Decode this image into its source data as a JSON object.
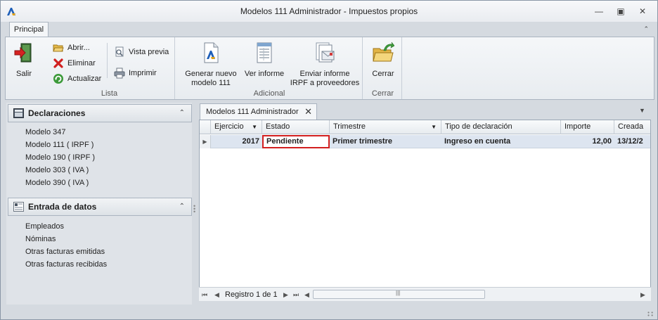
{
  "window": {
    "title": "Modelos 111 Administrador - Impuestos propios"
  },
  "ribbon": {
    "tabs": [
      "Principal"
    ],
    "salir": "Salir",
    "abrir": "Abrir...",
    "eliminar": "Eliminar",
    "actualizar": "Actualizar",
    "vista_previa": "Vista previa",
    "imprimir": "Imprimir",
    "group_lista": "Lista",
    "generar_line1": "Generar nuevo",
    "generar_line2": "modelo 111",
    "ver_informe": "Ver informe",
    "enviar_line1": "Enviar informe",
    "enviar_line2": "IRPF a proveedores",
    "group_adicional": "Adicional",
    "cerrar": "Cerrar",
    "group_cerrar": "Cerrar"
  },
  "sidebar": {
    "declaraciones": {
      "title": "Declaraciones",
      "items": [
        "Modelo 347",
        "Modelo 111 ( IRPF )",
        "Modelo 190 ( IRPF )",
        "Modelo 303 ( IVA )",
        "Modelo 390 ( IVA )"
      ]
    },
    "entrada": {
      "title": "Entrada de datos",
      "items": [
        "Empleados",
        "Nóminas",
        "Otras facturas emitidas",
        "Otras facturas recibidas"
      ]
    }
  },
  "document_tab": {
    "label": "Modelos 111 Administrador"
  },
  "grid": {
    "columns": [
      "Ejercicio",
      "Estado",
      "Trimestre",
      "Tipo de declaración",
      "Importe",
      "Creada"
    ],
    "rows": [
      {
        "ejercicio": "2017",
        "estado": "Pendiente",
        "trimestre": "Primer trimestre",
        "tipo": "Ingreso en cuenta",
        "importe": "12,00",
        "creada": "13/12/2"
      }
    ]
  },
  "navigator": {
    "record_text": "Registro 1 de 1"
  },
  "colors": {
    "focus_border": "#d21f1f",
    "row_selected": "#dde5f0",
    "accent": "#1f5fb8"
  }
}
